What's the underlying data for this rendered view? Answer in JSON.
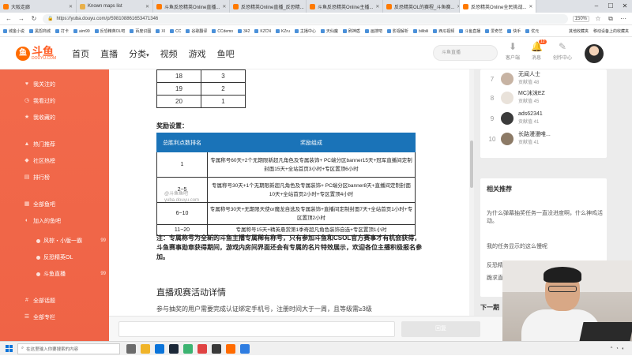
{
  "browser": {
    "tabs": [
      {
        "label": "大阪走廊",
        "active": false
      },
      {
        "label": "Known maps list",
        "active": false
      },
      {
        "label": "斗鱼反恐精英Online直播...",
        "active": false
      },
      {
        "label": "反恐精英Online直播_反恐精...",
        "active": false
      },
      {
        "label": "斗鱼反恐精英Online主播...",
        "active": false
      },
      {
        "label": "反恐精英OL的赛程_斗鱼赛...",
        "active": true
      },
      {
        "label": "反恐精英Online全民挑战...",
        "active": false
      }
    ],
    "url": "https://yuba.douyu.com/p/598108861653471346",
    "zoom": "150%",
    "bookmarks": [
      "城金小说",
      "黑怨商城",
      "打卡",
      "aim99",
      "反恐精英OL吧",
      "百度识图",
      "XI",
      "CC",
      "谷歌翻译",
      "CCdemo",
      "342",
      "KZCN",
      "KZru",
      "主播中心",
      "天仙魔",
      "刷神盾",
      "画搜吧",
      "影视解析",
      "bilibili",
      "西瓜视频",
      "斗鱼直播",
      "爱奇艺",
      "快手",
      "优元"
    ],
    "bookmarks_right": [
      "其他收藏夹",
      "移动设备上的收藏夹"
    ]
  },
  "header": {
    "logo_main": "斗鱼",
    "logo_sub": "DOUYU.COM",
    "nav": [
      "首页",
      "直播",
      "分类",
      "视频",
      "游戏",
      "鱼吧"
    ],
    "search_placeholder": "斗鱼直播",
    "icons": [
      {
        "label": "客户端",
        "badge": ""
      },
      {
        "label": "消息",
        "badge": "12"
      },
      {
        "label": "创作中心",
        "badge": ""
      }
    ]
  },
  "sidebar": {
    "items": [
      {
        "label": "我关注的",
        "count": ""
      },
      {
        "label": "我看过的",
        "count": ""
      },
      {
        "label": "我收藏的",
        "count": ""
      },
      {
        "label": "热门推荐",
        "count": ""
      },
      {
        "label": "社区热榜",
        "count": ""
      },
      {
        "label": "排行榜",
        "count": ""
      },
      {
        "label": "全部鱼吧",
        "count": ""
      },
      {
        "label": "加入的鱼吧",
        "count": ""
      }
    ],
    "sub_items": [
      {
        "label": "风棕・小版一霸",
        "count": "99"
      },
      {
        "label": "反恐精英OL",
        "count": ""
      },
      {
        "label": "斗鱼直播",
        "count": "99"
      }
    ],
    "bottom": [
      "全部话题",
      "全部专栏"
    ]
  },
  "article": {
    "rank_rows": [
      [
        "18",
        "3"
      ],
      [
        "19",
        "2"
      ],
      [
        "20",
        "1"
      ]
    ],
    "reward_title": "奖励设置：",
    "reward_headers": [
      "总胜利点数排名",
      "奖励组成"
    ],
    "reward_rows": [
      {
        "rank": "1",
        "reward": "专属称号60天+2个无期限新超凡角色及专属装饰+ PC端分区banner15天+冠军直播间定制封面15天+全站首页3小时+专区置顶6小时"
      },
      {
        "rank": "2~5",
        "reward": "专属称号30天+1个无期限新超凡角色及专属装饰+ PC端分区banner8天+直播间定制封面10天+全站首页2小时+专区置顶4小时"
      },
      {
        "rank": "6~10",
        "reward": "专属称号30天+无期限天使or魔龙自选及专属装饰+直播间定制封面7天+全站首页1小时+专区置顶2小时"
      },
      {
        "rank": "11~20",
        "reward": "专属称号15天+精英悬赏第1季奇超凡角色装饰自选+专区置顶1小时"
      }
    ],
    "watermark_line1": "@斗鱼鱼吧",
    "watermark_line2": "yuba.douyu.com",
    "note": "注：专属称号为全新的斗鱼主播专属稀有称号，只有参加斗鱼和CSOL官方赛事才有机会获得，斗鱼赛事勋章获得期间，游戏内房间界面还会有专属的名片特效展示，欢迎各位主播积极报名参加。",
    "section_heading": "直播观赛活动详情",
    "cut_line": "参与抽奖的用户需要完成认证绑定手机号，注册时间大于一周，且等级需≥3级"
  },
  "right": {
    "ranking": [
      {
        "num": "7",
        "name": "无闻人士",
        "score": "贡献值 48"
      },
      {
        "num": "8",
        "name": "MC沫沫EZ",
        "score": "贡献值 45"
      },
      {
        "num": "9",
        "name": "ads62341",
        "score": "贡献值 41"
      },
      {
        "num": "10",
        "name": "长路漫漫唯...",
        "score": "贡献值 41"
      }
    ],
    "rec_title": "相关推荐",
    "recommendations": [
      "为什么弹幕抽奖任务一直没进度啊，什么神鸡活动。",
      "我的任务显示的这么慢呢",
      "反恐精英...",
      "跪求直播..."
    ],
    "download_title": "下一期"
  },
  "comment": {
    "reply_label": "回复"
  },
  "taskbar": {
    "search_placeholder": "在这里输入你要搜索的内容",
    "time": "",
    "date": ""
  }
}
